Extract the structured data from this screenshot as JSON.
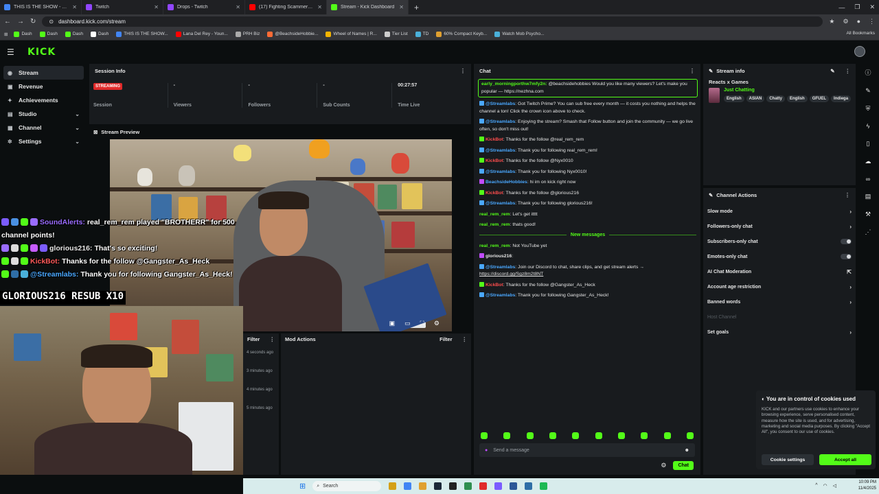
{
  "browser": {
    "tabs": [
      {
        "label": "THIS IS THE SHOW - Google Do",
        "color": "#4285f4",
        "active": false
      },
      {
        "label": "Twitch",
        "color": "#9146ff",
        "active": false
      },
      {
        "label": "Drops - Twitch",
        "color": "#9146ff",
        "active": false
      },
      {
        "label": "(17) Fighting Scammers in Paris",
        "color": "#ff0000",
        "active": false
      },
      {
        "label": "Stream - Kick Dashboard",
        "color": "#53fc18",
        "active": true
      }
    ],
    "url": "dashboard.kick.com/stream",
    "bookmarks": [
      {
        "label": "Dash",
        "color": "#53fc18"
      },
      {
        "label": "Dash",
        "color": "#53fc18"
      },
      {
        "label": "Dash",
        "color": "#53fc18"
      },
      {
        "label": "Dash",
        "color": "#ffffff"
      },
      {
        "label": "THIS IS THE SHOW...",
        "color": "#4285f4"
      },
      {
        "label": "Lana Del Rey - Youn...",
        "color": "#ff0000"
      },
      {
        "label": "PRH Biz",
        "color": "#aaaaaa"
      },
      {
        "label": "@BeachsideHobbie...",
        "color": "#ff6b35"
      },
      {
        "label": "Wheel of Names | R...",
        "color": "#f4b400"
      },
      {
        "label": "Tier List",
        "color": "#cccccc"
      },
      {
        "label": "TD",
        "color": "#4ab0d9"
      },
      {
        "label": "60% Compact Keyb...",
        "color": "#e0a030"
      },
      {
        "label": "Watch Mob Psycho...",
        "color": "#4ab0d9"
      }
    ],
    "all_bookmarks": "All Bookmarks"
  },
  "header": {
    "logo": "KICK"
  },
  "sidebar": {
    "items": [
      {
        "label": "Stream",
        "icon": "broadcast-icon",
        "glyph": "◉",
        "active": true,
        "chevron": false
      },
      {
        "label": "Revenue",
        "icon": "wallet-icon",
        "glyph": "▣",
        "active": false,
        "chevron": false
      },
      {
        "label": "Achievements",
        "icon": "trophy-icon",
        "glyph": "✦",
        "active": false,
        "chevron": false
      },
      {
        "label": "Studio",
        "icon": "studio-icon",
        "glyph": "▤",
        "active": false,
        "chevron": true
      },
      {
        "label": "Channel",
        "icon": "channel-icon",
        "glyph": "▦",
        "active": false,
        "chevron": true
      },
      {
        "label": "Settings",
        "icon": "gear-icon",
        "glyph": "✲",
        "active": false,
        "chevron": true
      }
    ]
  },
  "session": {
    "title": "Session Info",
    "status_badge": "STREAMING",
    "stats": [
      {
        "value": "",
        "label": "Session"
      },
      {
        "value": "-",
        "label": "Viewers"
      },
      {
        "value": "-",
        "label": "Followers"
      },
      {
        "value": "-",
        "label": "Sub Counts"
      },
      {
        "value": "00:27:57",
        "label": "Time Live"
      }
    ]
  },
  "preview": {
    "title": "Stream Preview"
  },
  "overlay": {
    "resub_text": "GLORIOUS216  RESUB X10",
    "chat": [
      {
        "user": "SoundAlerts:",
        "text": " real_rem_rem played \"BROTHERR\" for 500",
        "user_color": "#9a6cff",
        "badges": [
          "#7b5cff",
          "#4a90e2",
          "#53fc18",
          "#9a6cff"
        ]
      },
      {
        "user": "",
        "text": "channel points!",
        "user_color": "#ffffff",
        "badges": []
      },
      {
        "user": "glorious216:",
        "text": " That's so exciting!",
        "user_color": "#e6e6e6",
        "badges": [
          "#9a6cff",
          "#dcdcdc",
          "#53fc18",
          "#c65cff",
          "#7b5cff"
        ]
      },
      {
        "user": "KickBot:",
        "text": " Thanks for the follow @Gangster_As_Heck",
        "user_color": "#ff5a5a",
        "badges": [
          "#53fc18",
          "#dddddd",
          "#53fc18"
        ]
      },
      {
        "user": "@Streamlabs:",
        "text": " Thank you for following Gangster_As_Heck!",
        "user_color": "#4aa8ff",
        "badges": [
          "#53fc18",
          "#2f6ea6",
          "#4ab0d9"
        ]
      }
    ]
  },
  "filter": {
    "label": "Filter",
    "times": [
      "4 seconds ago",
      "3 minutes ago",
      "4 minutes ago",
      "5 minutes ago"
    ]
  },
  "mod_actions": {
    "title": "Mod Actions",
    "filter_label": "Filter"
  },
  "chat": {
    "title": "Chat",
    "highlight": {
      "user": "early_morningporthw7mfy2n:",
      "text": " @beachsidehobbies Would you like many viewers? Let's make you popular — https://nezhna.com"
    },
    "messages": [
      {
        "user": "@Streamlabs",
        "user_color": "#4aa8ff",
        "badge": "#4aa8ff",
        "text": ": Got Twitch Prime? You can sub free every month — it costs you nothing and helps the channel a ton! Click the crown icon above to check."
      },
      {
        "user": "@Streamlabs",
        "user_color": "#4aa8ff",
        "badge": "#4aa8ff",
        "text": ": Enjoying the stream? Smash that Follow button and join the community — we go live often, so don't miss out!"
      },
      {
        "user": "KickBot",
        "user_color": "#ff4d4d",
        "badge": "#53fc18",
        "text": ": Thanks for the follow @real_rem_rem"
      },
      {
        "user": "@Streamlabs",
        "user_color": "#4aa8ff",
        "badge": "#4aa8ff",
        "text": ": Thank you for following real_rem_rem!"
      },
      {
        "user": "KickBot",
        "user_color": "#ff4d4d",
        "badge": "#53fc18",
        "text": ": Thanks for the follow @Nyx0010"
      },
      {
        "user": "@Streamlabs",
        "user_color": "#4aa8ff",
        "badge": "#4aa8ff",
        "text": ": Thank you for following Nyx0010!"
      },
      {
        "user": "BeachsideHobbies",
        "user_color": "#4aa8ff",
        "badge": "#c04cff",
        "text": ": hi im on kick right now"
      },
      {
        "user": "KickBot",
        "user_color": "#ff4d4d",
        "badge": "#53fc18",
        "text": ": Thanks for the follow @glorious216"
      },
      {
        "user": "@Streamlabs",
        "user_color": "#4aa8ff",
        "badge": "#4aa8ff",
        "text": ": Thank you for following glorious216!"
      },
      {
        "user": "real_rem_rem",
        "user_color": "#53fc18",
        "badge": "",
        "text": ": Let's get itttt"
      },
      {
        "user": "real_rem_rem",
        "user_color": "#53fc18",
        "badge": "",
        "text": ": thats good!"
      }
    ],
    "new_messages_label": "New messages",
    "new_messages": [
      {
        "user": "real_rem_rem",
        "user_color": "#53fc18",
        "badge": "",
        "text": ": Not YouTube yet",
        "link": ""
      },
      {
        "user": "glorious216",
        "user_color": "#e6e6e6",
        "badge": "#c04cff",
        "text": ":",
        "link": ""
      },
      {
        "user": "@Streamlabs",
        "user_color": "#4aa8ff",
        "badge": "#4aa8ff",
        "text": ": Join our Discord to chat, share clips, and get stream alerts →",
        "link": "https://discord.gg/Sgz8m2t8NT"
      },
      {
        "user": "KickBot",
        "user_color": "#ff4d4d",
        "badge": "#53fc18",
        "text": ": Thanks for the follow @Gangster_As_Heck",
        "link": ""
      },
      {
        "user": "@Streamlabs",
        "user_color": "#4aa8ff",
        "badge": "#4aa8ff",
        "text": ": Thank you for following Gangster_As_Heck!",
        "link": ""
      }
    ],
    "input_placeholder": "Send a message",
    "send_label": "Chat"
  },
  "stream_info": {
    "title": "Stream info",
    "stream_title": "Reacts x Games",
    "category": "Just Chatting",
    "tags": [
      "English",
      "ASIAN",
      "Chatty",
      "English",
      "GFUEL",
      "Indiega"
    ]
  },
  "channel_actions": {
    "title": "Channel Actions",
    "items": [
      {
        "label": "Slow mode",
        "control": "chevron"
      },
      {
        "label": "Followers-only chat",
        "control": "chevron"
      },
      {
        "label": "Subscribers-only chat",
        "control": "toggle"
      },
      {
        "label": "Emotes-only chat",
        "control": "toggle"
      },
      {
        "label": "AI Chat Moderation",
        "control": "external"
      },
      {
        "label": "Account age restriction",
        "control": "chevron"
      },
      {
        "label": "Banned words",
        "control": "chevron"
      },
      {
        "label": "Host Channel",
        "control": "disabled"
      },
      {
        "label": "Set goals",
        "control": "chevron"
      }
    ]
  },
  "cookie": {
    "title": "You are in control of cookies used",
    "text": "KICK and our partners use cookies to enhance your browsing experience, serve personalised content, measure how the site is used, and for advertising, marketing and social media purposes. By clicking \"Accept All\", you consent to our use of cookies.",
    "settings_label": "Cookie settings",
    "accept_label": "Accept all"
  },
  "taskbar": {
    "search_placeholder": "Search",
    "time": "10:09 PM",
    "date": "11/4/2025"
  },
  "colors": {
    "accent": "#53fc18",
    "panel": "#181b1e",
    "background": "#0b0e0f"
  }
}
